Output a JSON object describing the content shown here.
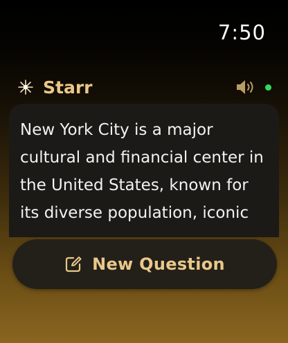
{
  "status_bar": {
    "time": "7:50"
  },
  "header": {
    "app_name": "Starr",
    "icon": "sparkle-icon",
    "speaker_icon": "speaker-icon"
  },
  "message": {
    "text": "New York City is a major cultural and financial center in the United States, known for its diverse population, iconic"
  },
  "actions": {
    "new_question_label": "New Question",
    "icon": "compose-icon"
  },
  "colors": {
    "accent": "#eac889",
    "status_dot": "#33d95c",
    "card": "#1c1a17"
  }
}
